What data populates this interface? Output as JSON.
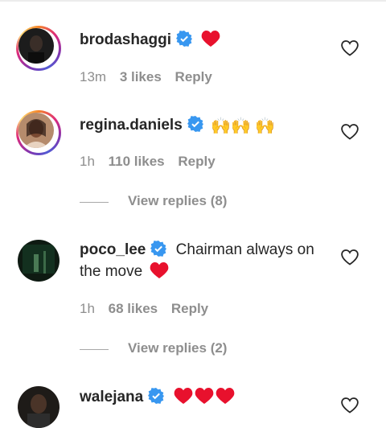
{
  "comments": [
    {
      "username": "brodashaggi",
      "text": "",
      "emoji": "heart",
      "time": "13m",
      "likes": "3 likes",
      "reply": "Reply",
      "avatar_icon": "avatar-dark"
    },
    {
      "username": "regina.daniels",
      "emoji_text": "🙌🙌 🙌",
      "time": "1h",
      "likes": "110 likes",
      "reply": "Reply",
      "view_replies": "View replies (8)",
      "avatar_icon": "avatar-woman"
    },
    {
      "username": "poco_lee",
      "text_line1": "Chairman always on",
      "text_line2": "the move",
      "time": "1h",
      "likes": "68 likes",
      "reply": "Reply",
      "view_replies": "View replies (2)",
      "avatar_icon": "avatar-green-stage"
    },
    {
      "username": "walejana",
      "emoji": "heart x3",
      "avatar_icon": "avatar-man"
    }
  ],
  "colors": {
    "text": "#262626",
    "muted": "#8e8e8e",
    "verified": "#3897f0",
    "heart": "#e8112d"
  },
  "icons": [
    "verified-icon",
    "heart-emoji-icon",
    "like-heart-icon"
  ]
}
